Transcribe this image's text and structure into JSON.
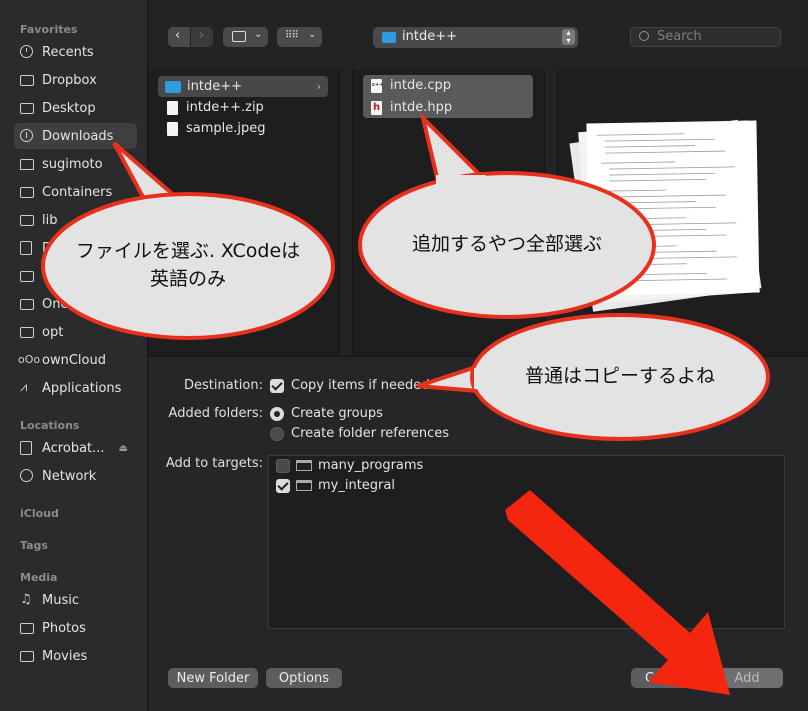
{
  "sidebar": {
    "favorites_header": "Favorites",
    "favorites": [
      {
        "label": "Recents",
        "icon": "clock-icon"
      },
      {
        "label": "Dropbox",
        "icon": "folder-icon"
      },
      {
        "label": "Desktop",
        "icon": "folder-icon"
      },
      {
        "label": "Downloads",
        "icon": "download-icon"
      },
      {
        "label": "sugimoto",
        "icon": "home-icon"
      },
      {
        "label": "Containers",
        "icon": "folder-icon"
      },
      {
        "label": "lib",
        "icon": "folder-icon"
      },
      {
        "label": "D",
        "icon": "document-icon"
      },
      {
        "label": "C",
        "icon": "folder-icon"
      },
      {
        "label": "One",
        "icon": "folder-icon"
      },
      {
        "label": "opt",
        "icon": "folder-icon"
      },
      {
        "label": "ownCloud",
        "icon": "owncloud-icon"
      },
      {
        "label": "Applications",
        "icon": "applications-icon"
      }
    ],
    "locations_header": "Locations",
    "locations": [
      {
        "label": "Acrobat...",
        "icon": "disk-icon"
      },
      {
        "label": "Network",
        "icon": "globe-icon"
      }
    ],
    "icloud_header": "iCloud",
    "tags_header": "Tags",
    "media_header": "Media",
    "media": [
      {
        "label": "Music",
        "icon": "music-icon"
      },
      {
        "label": "Photos",
        "icon": "camera-icon"
      },
      {
        "label": "Movies",
        "icon": "film-icon"
      }
    ]
  },
  "toolbar": {
    "location": "intde++",
    "search_placeholder": "Search"
  },
  "browser": {
    "col1": [
      {
        "label": "intde++",
        "type": "folder"
      },
      {
        "label": "intde++.zip",
        "type": "file"
      },
      {
        "label": "sample.jpeg",
        "type": "file"
      }
    ],
    "col2": [
      {
        "label": "intde.cpp",
        "badge": "c++"
      },
      {
        "label": "intde.hpp",
        "badge": "h"
      }
    ]
  },
  "options": {
    "destination_label": "Destination:",
    "destination_option": "Copy items if needed",
    "added_folders_label": "Added folders:",
    "create_groups": "Create groups",
    "create_folder_refs": "Create folder references",
    "targets_label": "Add to targets:",
    "targets": [
      {
        "label": "many_programs",
        "checked": false
      },
      {
        "label": "my_integral",
        "checked": true
      }
    ]
  },
  "buttons": {
    "new_folder": "New Folder",
    "options": "Options",
    "cancel": "Cancel",
    "add": "Add"
  },
  "callouts": {
    "select_file": "ファイルを選ぶ. XCodeは英語のみ",
    "select_all": "追加するやつ全部選ぶ",
    "usually_copy": "普通はコピーするよね"
  },
  "colors": {
    "callout_fill": "#e3e3e3",
    "callout_border": "#e8301c",
    "arrow": "#f5260f",
    "accent_folder": "#2f9be0"
  }
}
